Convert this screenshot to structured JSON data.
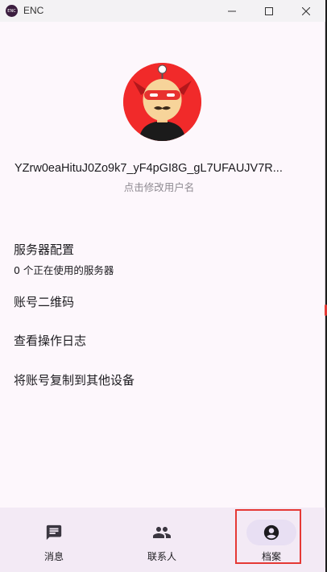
{
  "window": {
    "title": "ENC",
    "app_icon_text": "ENC"
  },
  "profile": {
    "username": "YZrw0eaHituJ0Zo9k7_yF4pGI8G_gL7UFAUJV7R...",
    "username_hint": "点击修改用户名"
  },
  "menu": {
    "server_config": {
      "title": "服务器配置",
      "subtitle": "0 个正在使用的服务器"
    },
    "account_qr": "账号二维码",
    "operation_log": "查看操作日志",
    "copy_account": "将账号复制到其他设备"
  },
  "bottom_nav": {
    "items": [
      {
        "label": "消息",
        "icon": "chat-icon",
        "selected": false
      },
      {
        "label": "联系人",
        "icon": "people-icon",
        "selected": false
      },
      {
        "label": "档案",
        "icon": "account-circle-icon",
        "selected": true
      }
    ]
  },
  "colors": {
    "background": "#fdf7fc",
    "nav_background": "#f3eaf5",
    "selected_pill": "#e8dff3",
    "avatar_red": "#f12a2a",
    "highlight": "#e53935"
  }
}
